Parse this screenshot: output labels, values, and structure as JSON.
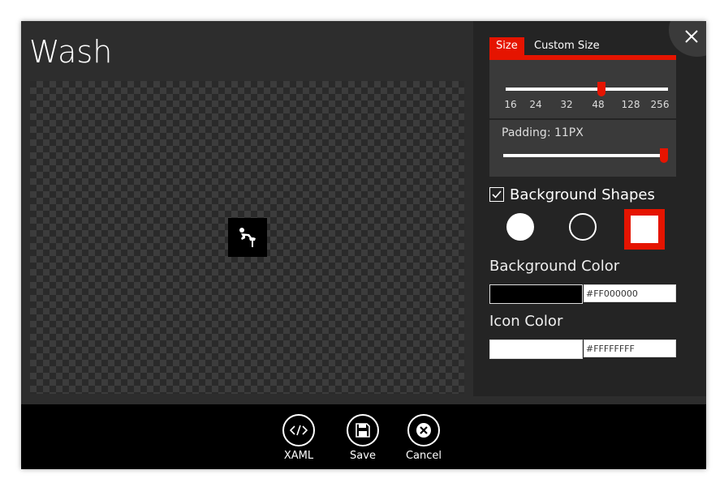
{
  "window": {
    "title": "Wash"
  },
  "icons": {
    "preview": "person-washing-icon",
    "close": "close-icon"
  },
  "tabs": {
    "size_label": "Size",
    "custom_label": "Custom Size"
  },
  "size_slider": {
    "ticks": [
      "16",
      "24",
      "32",
      "48",
      "128",
      "256"
    ],
    "selected": "48"
  },
  "padding": {
    "label": "Padding: 11PX",
    "value_fraction": 1.0
  },
  "background_shapes": {
    "label": "Background Shapes",
    "checked": true,
    "selected": "square",
    "options": [
      "filled-circle",
      "outline-circle",
      "square"
    ]
  },
  "background_color": {
    "label": "Background Color",
    "value": "#FF000000",
    "swatch": "#000000"
  },
  "icon_color": {
    "label": "Icon Color",
    "value": "#FFFFFFFF",
    "swatch": "#FFFFFF"
  },
  "footer": {
    "xaml_label": "XAML",
    "save_label": "Save",
    "cancel_label": "Cancel"
  },
  "colors": {
    "accent": "#E51400",
    "panel": "#242424",
    "window": "#2D2D2D"
  }
}
